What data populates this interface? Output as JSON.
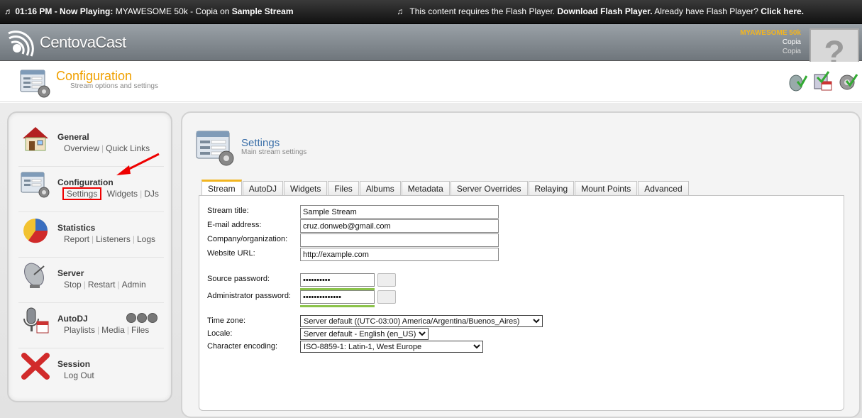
{
  "topbar": {
    "time": "01:16 PM",
    "now_playing_label": " - Now Playing: ",
    "track": "MYAWESOME 50k - Copia",
    "on_label": " on ",
    "stream_name": "Sample Stream",
    "flash_msg": "This content requires the Flash Player.",
    "flash_download": "Download Flash Player.",
    "flash_have": "Already have Flash Player?",
    "flash_click": "Click here."
  },
  "header": {
    "logo_text": "CentovaCast",
    "username": "MYAWESOME 50k",
    "sub1": "Copia",
    "sub2": "Copia",
    "avatar_glyph": "?"
  },
  "page": {
    "title": "Configuration",
    "subtitle": "Stream options and settings"
  },
  "sidebar": {
    "groups": [
      {
        "title": "General",
        "links": [
          "Overview",
          "Quick Links"
        ]
      },
      {
        "title": "Configuration",
        "links": [
          "Settings",
          "Widgets",
          "DJs"
        ]
      },
      {
        "title": "Statistics",
        "links": [
          "Report",
          "Listeners",
          "Logs"
        ]
      },
      {
        "title": "Server",
        "links": [
          "Stop",
          "Restart",
          "Admin"
        ]
      },
      {
        "title": "AutoDJ",
        "links": [
          "Playlists",
          "Media",
          "Files"
        ]
      },
      {
        "title": "Session",
        "links": [
          "Log Out"
        ]
      }
    ]
  },
  "panel": {
    "title": "Settings",
    "subtitle": "Main stream settings",
    "tabs": [
      "Stream",
      "AutoDJ",
      "Widgets",
      "Files",
      "Albums",
      "Metadata",
      "Server Overrides",
      "Relaying",
      "Mount Points",
      "Advanced"
    ],
    "active_tab": "Stream"
  },
  "form": {
    "stream_title_label": "Stream title:",
    "stream_title": "Sample Stream",
    "email_label": "E-mail address:",
    "email": "cruz.donweb@gmail.com",
    "company_label": "Company/organization:",
    "company": "",
    "website_label": "Website URL:",
    "website": "http://example.com",
    "source_pw_label": "Source password:",
    "source_pw": "••••••••••",
    "admin_pw_label": "Administrator password:",
    "admin_pw": "••••••••••••••",
    "timezone_label": "Time zone:",
    "timezone": "Server default ((UTC-03:00) America/Argentina/Buenos_Aires)",
    "locale_label": "Locale:",
    "locale": "Server default - English (en_US)",
    "encoding_label": "Character encoding:",
    "encoding": "ISO-8859-1: Latin-1, West Europe"
  },
  "colors": {
    "accent": "#f2b520",
    "title_orange": "#f0a000",
    "link_blue": "#3b6fa8",
    "highlight_red": "#e00000",
    "strength_green": "#8bc34a"
  }
}
